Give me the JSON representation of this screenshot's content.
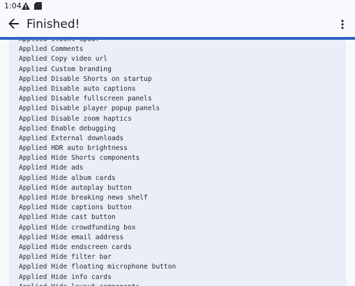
{
  "status_bar": {
    "time": "1:04",
    "icons": [
      "warning-icon",
      "sd-card-icon"
    ]
  },
  "app_bar": {
    "title": "Finished!",
    "back_icon": "arrow-back-icon",
    "menu_icon": "more-vert-icon"
  },
  "progress": {
    "fraction": 1.0,
    "color": "#2f63c2",
    "track_color": "#c8d8ef"
  },
  "colors": {
    "background": "#f7f9fc",
    "log_panel": "#e9eef8"
  },
  "log": {
    "lines": [
      "Applied Client spoof",
      "Applied Comments",
      "Applied Copy video url",
      "Applied Custom branding",
      "Applied Disable Shorts on startup",
      "Applied Disable auto captions",
      "Applied Disable fullscreen panels",
      "Applied Disable player popup panels",
      "Applied Disable zoom haptics",
      "Applied Enable debugging",
      "Applied External downloads",
      "Applied HDR auto brightness",
      "Applied Hide Shorts components",
      "Applied Hide ads",
      "Applied Hide album cards",
      "Applied Hide autoplay button",
      "Applied Hide breaking news shelf",
      "Applied Hide captions button",
      "Applied Hide cast button",
      "Applied Hide crowdfunding box",
      "Applied Hide email address",
      "Applied Hide endscreen cards",
      "Applied Hide filter bar",
      "Applied Hide floating microphone button",
      "Applied Hide info cards",
      "Applied Hide layout components"
    ]
  }
}
